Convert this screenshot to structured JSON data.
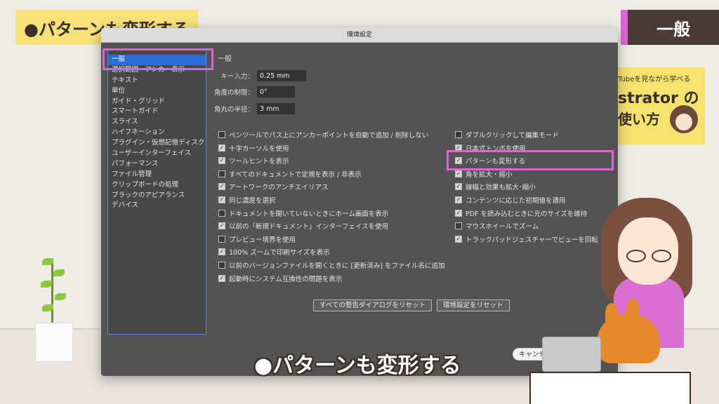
{
  "video": {
    "title": "●パターンも変形する",
    "section": "一般",
    "subtitle": "●パターンも変形する",
    "promo": {
      "line1": "Tubeを見ながら学べる",
      "line2": "strator の",
      "line3": "使い方"
    },
    "accent_color": "#e064d8"
  },
  "dialog": {
    "title": "環境設定",
    "sidebar": {
      "items": [
        {
          "label": "一般",
          "selected": true
        },
        {
          "label": "選択範囲・アンカー表示"
        },
        {
          "label": "テキスト"
        },
        {
          "label": "単位"
        },
        {
          "label": "ガイド・グリッド"
        },
        {
          "label": "スマートガイド"
        },
        {
          "label": "スライス"
        },
        {
          "label": "ハイフネーション"
        },
        {
          "label": "プラグイン・仮想記憶ディスク"
        },
        {
          "label": "ユーザーインターフェイス"
        },
        {
          "label": "パフォーマンス"
        },
        {
          "label": "ファイル管理"
        },
        {
          "label": "クリップボードの処理"
        },
        {
          "label": "ブラックのアピアランス"
        },
        {
          "label": "デバイス"
        }
      ]
    },
    "section_title": "一般",
    "fields": {
      "keyboard_increment": {
        "label": "キー入力：",
        "value": "0.25 mm"
      },
      "constrain_angle": {
        "label": "角度の制限：",
        "value": "0°"
      },
      "corner_radius": {
        "label": "角丸の半径：",
        "value": "3 mm"
      }
    },
    "left_checkboxes": [
      {
        "label": "ペンツールでパス上にアンカーポイントを自動で追加 / 削除しない",
        "checked": false
      },
      {
        "label": "十字カーソルを使用",
        "checked": true
      },
      {
        "label": "ツールヒントを表示",
        "checked": true
      },
      {
        "label": "すべてのドキュメントで定規を表示 / 非表示",
        "checked": false
      },
      {
        "label": "アートワークのアンチエイリアス",
        "checked": true
      },
      {
        "label": "同じ濃度を選択",
        "checked": true
      },
      {
        "label": "ドキュメントを開いていないときにホーム画面を表示",
        "checked": false
      },
      {
        "label": "以前の「新規ドキュメント」インターフェイスを使用",
        "checked": true
      },
      {
        "label": "プレビュー境界を使用",
        "checked": false
      },
      {
        "label": "100% ズームで印刷サイズを表示",
        "checked": true
      },
      {
        "label": "以前のバージョンファイルを開くときに [更新済み] をファイル名に追加",
        "checked": false
      },
      {
        "label": "起動時にシステム互換性の問題を表示",
        "checked": true
      }
    ],
    "right_checkboxes": [
      {
        "label": "ダブルクリックして編集モード",
        "checked": false
      },
      {
        "label": "日本式トンボを使用",
        "checked": true
      },
      {
        "label": "パターンも変形する",
        "checked": true
      },
      {
        "label": "角を拡大・縮小",
        "checked": true
      },
      {
        "label": "線幅と効果も拡大･縮小",
        "checked": true
      },
      {
        "label": "コンテンツに応じた初期値を適用",
        "checked": true
      },
      {
        "label": "PDF を読み込むときに元のサイズを維持",
        "checked": true
      },
      {
        "label": "マウスホイールでズーム",
        "checked": false
      },
      {
        "label": "トラックパッドジェスチャーでビューを回転",
        "checked": true
      }
    ],
    "buttons": {
      "reset_warnings": "すべての警告ダイアログをリセット",
      "reset_prefs": "環境設定をリセット",
      "cancel": "キャンセル"
    }
  }
}
